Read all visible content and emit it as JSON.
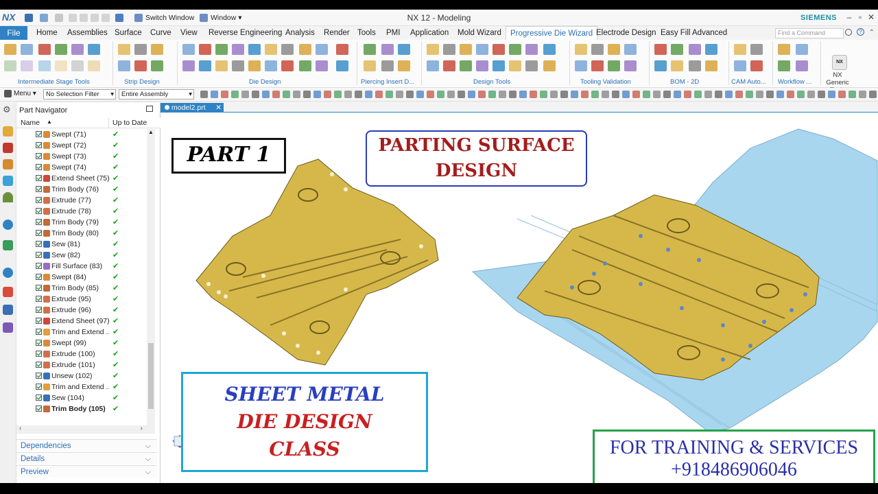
{
  "title_bar": {
    "app_logo": "NX",
    "window_title": "NX 12 - Modeling",
    "brand": "SIEMENS",
    "switch_window": "Switch Window",
    "window_menu": "Window ▾"
  },
  "menu": {
    "file_label": "File",
    "tabs": [
      "Home",
      "Assemblies",
      "Surface",
      "Curve",
      "View",
      "Reverse Engineering",
      "Analysis",
      "Render",
      "Tools",
      "PMI",
      "Application",
      "Mold Wizard",
      "Progressive Die Wizard",
      "Electrode Design",
      "Easy Fill Advanced"
    ],
    "active_tab": "Progressive Die Wizard",
    "search_placeholder": "Find a Command"
  },
  "ribbon": {
    "groups": [
      "Intermediate Stage Tools",
      "Strip Design",
      "Die Design",
      "Piercing Insert D...",
      "Design Tools",
      "Tooling Validation",
      "BOM - 2D",
      "CAM Auto...",
      "Workflow ..."
    ],
    "nx_generic_tools": "NX Generic Tools"
  },
  "toolbar": {
    "menu_label": "Menu ▾",
    "selection_filter": "No Selection Filter",
    "assembly_scope": "Entire Assembly"
  },
  "part_navigator": {
    "title": "Part Navigator",
    "columns": {
      "name": "Name",
      "status": "Up to Date"
    },
    "rows": [
      {
        "label": "Swept (71)",
        "kind": "swept"
      },
      {
        "label": "Swept (72)",
        "kind": "swept"
      },
      {
        "label": "Swept (73)",
        "kind": "swept"
      },
      {
        "label": "Swept (74)",
        "kind": "swept"
      },
      {
        "label": "Extend Sheet (75)",
        "kind": "extend"
      },
      {
        "label": "Trim Body (76)",
        "kind": "trim"
      },
      {
        "label": "Extrude (77)",
        "kind": "extrude"
      },
      {
        "label": "Extrude (78)",
        "kind": "extrude"
      },
      {
        "label": "Trim Body (79)",
        "kind": "trim"
      },
      {
        "label": "Trim Body (80)",
        "kind": "trim"
      },
      {
        "label": "Sew (81)",
        "kind": "sew"
      },
      {
        "label": "Sew (82)",
        "kind": "sew"
      },
      {
        "label": "Fill Surface (83)",
        "kind": "fill"
      },
      {
        "label": "Swept (84)",
        "kind": "swept"
      },
      {
        "label": "Trim Body (85)",
        "kind": "trim"
      },
      {
        "label": "Extrude (95)",
        "kind": "extrude"
      },
      {
        "label": "Extrude (96)",
        "kind": "extrude"
      },
      {
        "label": "Extend Sheet (97)",
        "kind": "extend"
      },
      {
        "label": "Trim and Extend ...",
        "kind": "trimext"
      },
      {
        "label": "Swept (99)",
        "kind": "swept"
      },
      {
        "label": "Extrude (100)",
        "kind": "extrude"
      },
      {
        "label": "Extrude (101)",
        "kind": "extrude"
      },
      {
        "label": "Unsew (102)",
        "kind": "sew"
      },
      {
        "label": "Trim and Extend ...",
        "kind": "trimext"
      },
      {
        "label": "Sew (104)",
        "kind": "sew"
      },
      {
        "label": "Trim Body (105)",
        "kind": "trim",
        "bold": true
      }
    ],
    "panels": [
      "Dependencies",
      "Details",
      "Preview"
    ]
  },
  "document": {
    "tab_label": "model2.prt"
  },
  "overlays": {
    "part1": "PART 1",
    "parting_line1": "PARTING SURFACE",
    "parting_line2": "DESIGN",
    "sheet_line1": "SHEET METAL",
    "sheet_line2": "DIE DESIGN",
    "sheet_line3": "CLASS",
    "training_line1": "FOR TRAINING & SERVICES",
    "training_line2": "+918486906046"
  },
  "colors": {
    "accent": "#2f82c4",
    "part": "#d6b84a",
    "parting_surface": "#a9d6ee",
    "ok_green": "#1a9e1a"
  }
}
